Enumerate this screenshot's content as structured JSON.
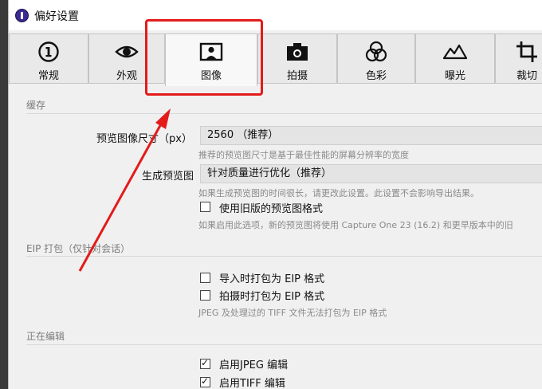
{
  "window": {
    "title": "偏好设置"
  },
  "tabs": [
    {
      "label": "常规",
      "icon": "info-circle-icon"
    },
    {
      "label": "外观",
      "icon": "eye-icon"
    },
    {
      "label": "图像",
      "icon": "portrait-frame-icon",
      "active": true
    },
    {
      "label": "拍摄",
      "icon": "camera-icon"
    },
    {
      "label": "色彩",
      "icon": "color-circles-icon"
    },
    {
      "label": "曝光",
      "icon": "mountain-icon"
    },
    {
      "label": "裁切",
      "icon": "crop-icon"
    }
  ],
  "cache": {
    "heading": "缓存",
    "preview_size_label": "预览图像尺寸（px）",
    "preview_size_value": "2560  （推荐）",
    "preview_size_hint": "推荐的预览图尺寸是基于最佳性能的屏幕分辨率的宽度",
    "generate_label": "生成预览图",
    "generate_value": "针对质量进行优化（推荐）",
    "generate_hint": "如果生成预览图的时间很长，请更改此设置。此设置不会影响导出结果。",
    "legacy_label": "使用旧版的预览图格式",
    "legacy_checked": false,
    "legacy_hint": "如果启用此选项，新的预览图将使用 Capture One 23 (16.2) 和更早版本中的旧"
  },
  "eip": {
    "heading": "EIP 打包（仅针对会话）",
    "import_label": "导入时打包为 EIP 格式",
    "import_checked": false,
    "capture_label": "拍摄时打包为 EIP 格式",
    "capture_checked": false,
    "hint": "JPEG 及处理过的 TIFF 文件无法打包为 EIP 格式"
  },
  "editing": {
    "heading": "正在编辑",
    "jpeg_label": "启用JPEG 编辑",
    "jpeg_checked": true,
    "tiff_label": "启用TIFF 编辑",
    "tiff_checked": true
  },
  "colors": {
    "annotation": "#e31b1b",
    "tab_active_bg": "#f8f8f8",
    "tab_bg": "#e9e9e9",
    "app_icon": "#3b2a8f"
  }
}
